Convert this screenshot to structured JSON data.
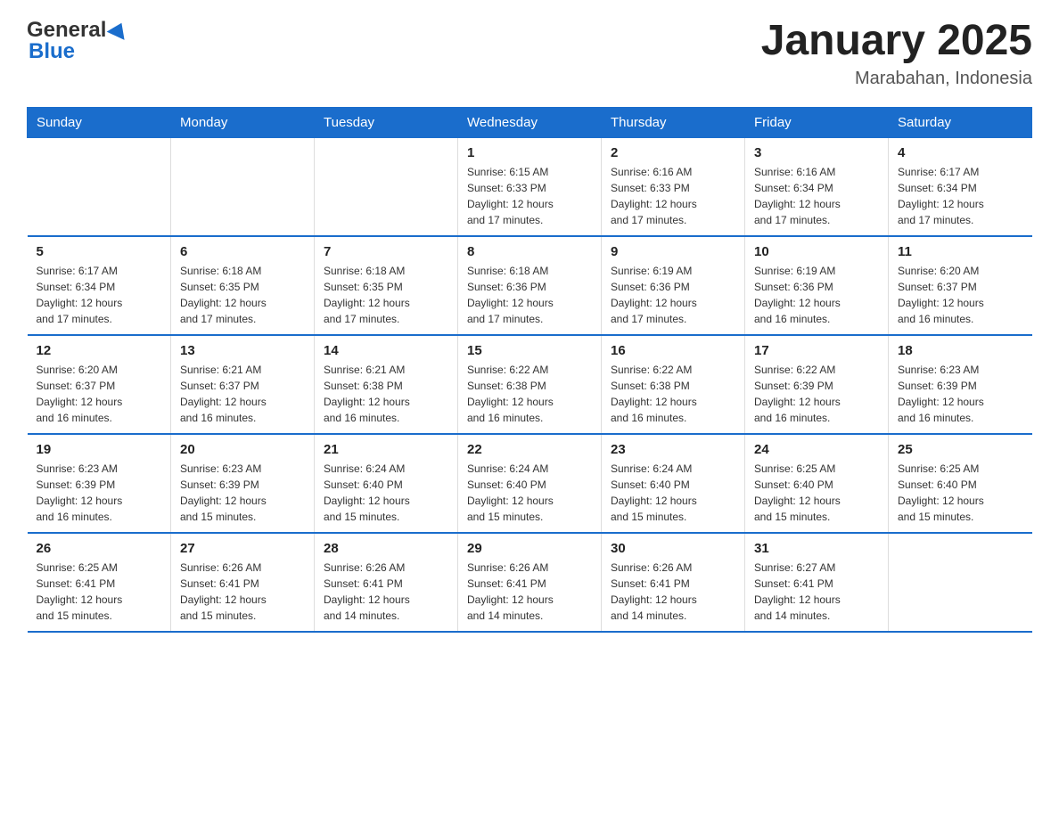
{
  "header": {
    "logo_general": "General",
    "logo_blue": "Blue",
    "month_title": "January 2025",
    "location": "Marabahan, Indonesia"
  },
  "days_of_week": [
    "Sunday",
    "Monday",
    "Tuesday",
    "Wednesday",
    "Thursday",
    "Friday",
    "Saturday"
  ],
  "weeks": [
    [
      {
        "day": "",
        "info": ""
      },
      {
        "day": "",
        "info": ""
      },
      {
        "day": "",
        "info": ""
      },
      {
        "day": "1",
        "info": "Sunrise: 6:15 AM\nSunset: 6:33 PM\nDaylight: 12 hours\nand 17 minutes."
      },
      {
        "day": "2",
        "info": "Sunrise: 6:16 AM\nSunset: 6:33 PM\nDaylight: 12 hours\nand 17 minutes."
      },
      {
        "day": "3",
        "info": "Sunrise: 6:16 AM\nSunset: 6:34 PM\nDaylight: 12 hours\nand 17 minutes."
      },
      {
        "day": "4",
        "info": "Sunrise: 6:17 AM\nSunset: 6:34 PM\nDaylight: 12 hours\nand 17 minutes."
      }
    ],
    [
      {
        "day": "5",
        "info": "Sunrise: 6:17 AM\nSunset: 6:34 PM\nDaylight: 12 hours\nand 17 minutes."
      },
      {
        "day": "6",
        "info": "Sunrise: 6:18 AM\nSunset: 6:35 PM\nDaylight: 12 hours\nand 17 minutes."
      },
      {
        "day": "7",
        "info": "Sunrise: 6:18 AM\nSunset: 6:35 PM\nDaylight: 12 hours\nand 17 minutes."
      },
      {
        "day": "8",
        "info": "Sunrise: 6:18 AM\nSunset: 6:36 PM\nDaylight: 12 hours\nand 17 minutes."
      },
      {
        "day": "9",
        "info": "Sunrise: 6:19 AM\nSunset: 6:36 PM\nDaylight: 12 hours\nand 17 minutes."
      },
      {
        "day": "10",
        "info": "Sunrise: 6:19 AM\nSunset: 6:36 PM\nDaylight: 12 hours\nand 16 minutes."
      },
      {
        "day": "11",
        "info": "Sunrise: 6:20 AM\nSunset: 6:37 PM\nDaylight: 12 hours\nand 16 minutes."
      }
    ],
    [
      {
        "day": "12",
        "info": "Sunrise: 6:20 AM\nSunset: 6:37 PM\nDaylight: 12 hours\nand 16 minutes."
      },
      {
        "day": "13",
        "info": "Sunrise: 6:21 AM\nSunset: 6:37 PM\nDaylight: 12 hours\nand 16 minutes."
      },
      {
        "day": "14",
        "info": "Sunrise: 6:21 AM\nSunset: 6:38 PM\nDaylight: 12 hours\nand 16 minutes."
      },
      {
        "day": "15",
        "info": "Sunrise: 6:22 AM\nSunset: 6:38 PM\nDaylight: 12 hours\nand 16 minutes."
      },
      {
        "day": "16",
        "info": "Sunrise: 6:22 AM\nSunset: 6:38 PM\nDaylight: 12 hours\nand 16 minutes."
      },
      {
        "day": "17",
        "info": "Sunrise: 6:22 AM\nSunset: 6:39 PM\nDaylight: 12 hours\nand 16 minutes."
      },
      {
        "day": "18",
        "info": "Sunrise: 6:23 AM\nSunset: 6:39 PM\nDaylight: 12 hours\nand 16 minutes."
      }
    ],
    [
      {
        "day": "19",
        "info": "Sunrise: 6:23 AM\nSunset: 6:39 PM\nDaylight: 12 hours\nand 16 minutes."
      },
      {
        "day": "20",
        "info": "Sunrise: 6:23 AM\nSunset: 6:39 PM\nDaylight: 12 hours\nand 15 minutes."
      },
      {
        "day": "21",
        "info": "Sunrise: 6:24 AM\nSunset: 6:40 PM\nDaylight: 12 hours\nand 15 minutes."
      },
      {
        "day": "22",
        "info": "Sunrise: 6:24 AM\nSunset: 6:40 PM\nDaylight: 12 hours\nand 15 minutes."
      },
      {
        "day": "23",
        "info": "Sunrise: 6:24 AM\nSunset: 6:40 PM\nDaylight: 12 hours\nand 15 minutes."
      },
      {
        "day": "24",
        "info": "Sunrise: 6:25 AM\nSunset: 6:40 PM\nDaylight: 12 hours\nand 15 minutes."
      },
      {
        "day": "25",
        "info": "Sunrise: 6:25 AM\nSunset: 6:40 PM\nDaylight: 12 hours\nand 15 minutes."
      }
    ],
    [
      {
        "day": "26",
        "info": "Sunrise: 6:25 AM\nSunset: 6:41 PM\nDaylight: 12 hours\nand 15 minutes."
      },
      {
        "day": "27",
        "info": "Sunrise: 6:26 AM\nSunset: 6:41 PM\nDaylight: 12 hours\nand 15 minutes."
      },
      {
        "day": "28",
        "info": "Sunrise: 6:26 AM\nSunset: 6:41 PM\nDaylight: 12 hours\nand 14 minutes."
      },
      {
        "day": "29",
        "info": "Sunrise: 6:26 AM\nSunset: 6:41 PM\nDaylight: 12 hours\nand 14 minutes."
      },
      {
        "day": "30",
        "info": "Sunrise: 6:26 AM\nSunset: 6:41 PM\nDaylight: 12 hours\nand 14 minutes."
      },
      {
        "day": "31",
        "info": "Sunrise: 6:27 AM\nSunset: 6:41 PM\nDaylight: 12 hours\nand 14 minutes."
      },
      {
        "day": "",
        "info": ""
      }
    ]
  ]
}
